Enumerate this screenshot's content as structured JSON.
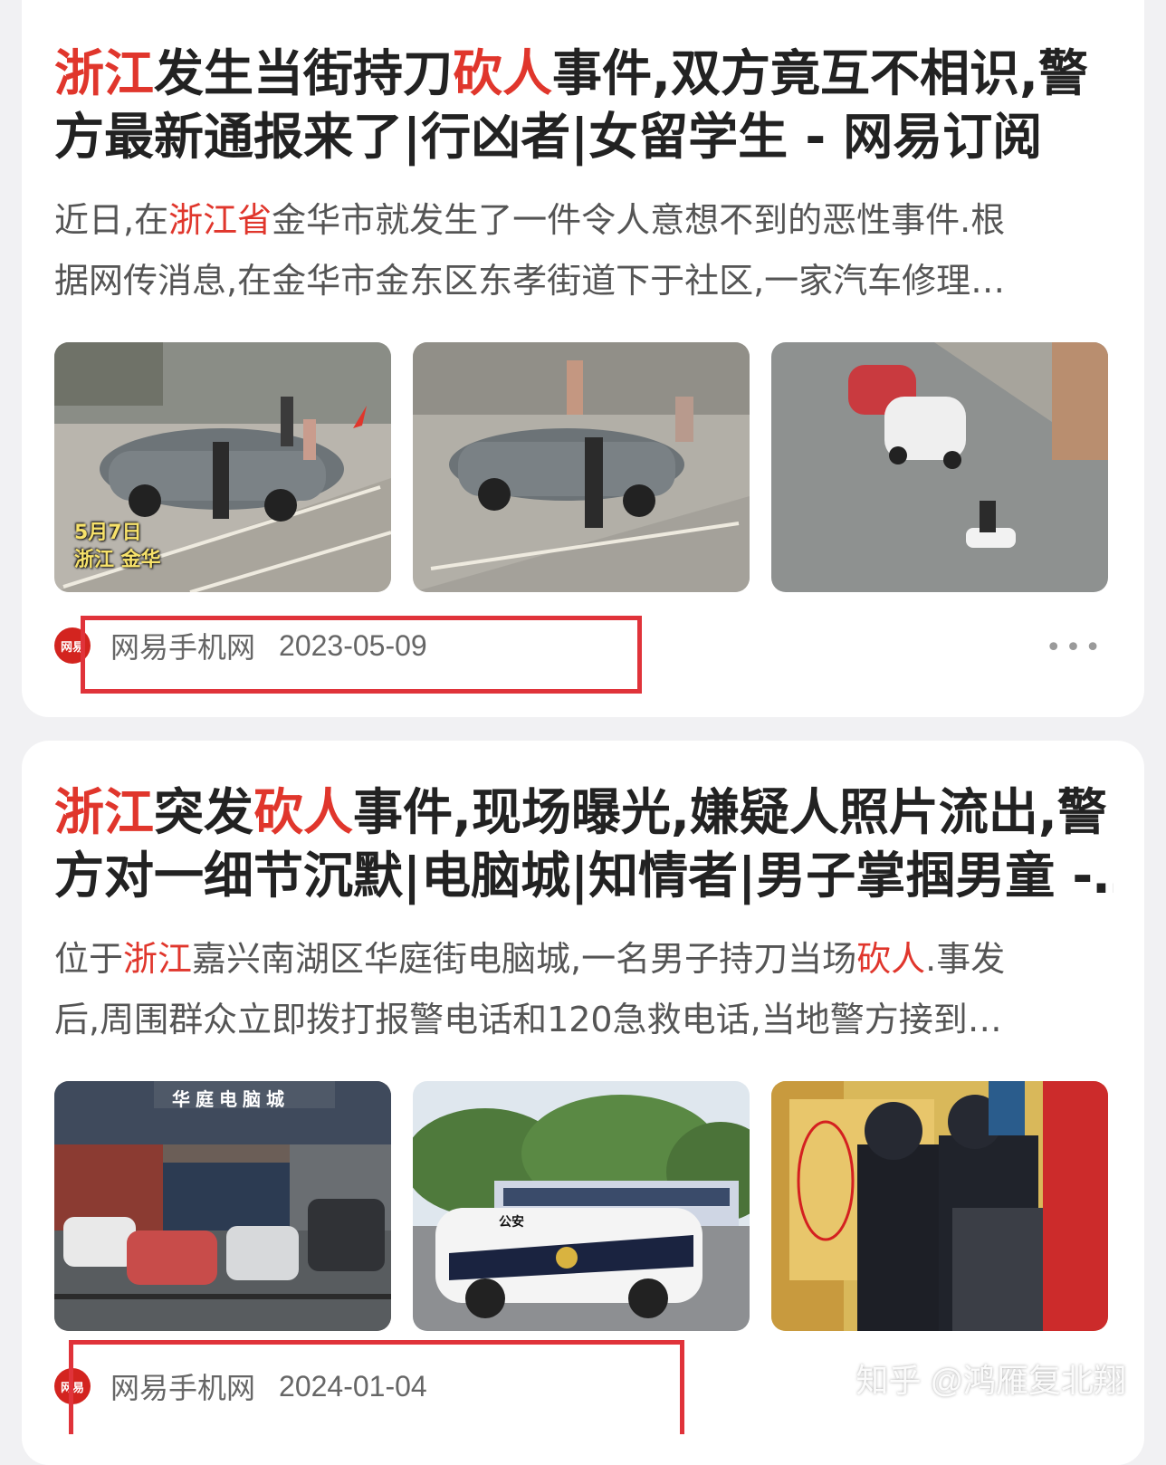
{
  "results": [
    {
      "title_line1": [
        {
          "text": "浙江",
          "hl": true
        },
        {
          "text": "发生当街持刀",
          "hl": false
        },
        {
          "text": "砍人",
          "hl": true
        },
        {
          "text": "事件,双方竟互不相识,警",
          "hl": false
        }
      ],
      "title_line2": [
        {
          "text": "方最新通报来了|行凶者|女留学生 - 网易订阅",
          "hl": false
        }
      ],
      "snippet_line1": [
        {
          "text": "近日,在",
          "hl": false
        },
        {
          "text": "浙江省",
          "hl": true
        },
        {
          "text": "金华市就发生了一件令人意想不到的恶性事件.根",
          "hl": false
        }
      ],
      "snippet_line2": [
        {
          "text": "据网传消息,在金华市金东区东孝街道下于社区,一家汽车修理…",
          "hl": false
        }
      ],
      "photo_caption_1": "5月7日",
      "photo_caption_2": "浙江 金华",
      "source": "网易手机网",
      "date": "2023-05-09",
      "more": "•••"
    },
    {
      "title_line1": [
        {
          "text": "浙江",
          "hl": true
        },
        {
          "text": "突发",
          "hl": false
        },
        {
          "text": "砍人",
          "hl": true
        },
        {
          "text": "事件,现场曝光,嫌疑人照片流出,警",
          "hl": false
        }
      ],
      "title_line2": [
        {
          "text": "方对一细节沉默|电脑城|知情者|男子掌掴男童 -…",
          "hl": false
        }
      ],
      "snippet_line1": [
        {
          "text": "位于",
          "hl": false
        },
        {
          "text": "浙江",
          "hl": true
        },
        {
          "text": "嘉兴南湖区华庭街电脑城,一名男子持刀当场",
          "hl": false
        },
        {
          "text": "砍人",
          "hl": true
        },
        {
          "text": ".事发",
          "hl": false
        }
      ],
      "snippet_line2": [
        {
          "text": "后,周围群众立即拨打报警电话和120急救电话,当地警方接到…",
          "hl": false
        }
      ],
      "photo_sign": "华庭电脑城",
      "photo_car_text": "公安",
      "source": "网易手机网",
      "date": "2024-01-04"
    }
  ],
  "logo_text": "网易",
  "watermark": "知乎 @鸿雁复北翔",
  "colors": {
    "highlight": "#e0362c",
    "annotation_box": "#e0333a"
  }
}
